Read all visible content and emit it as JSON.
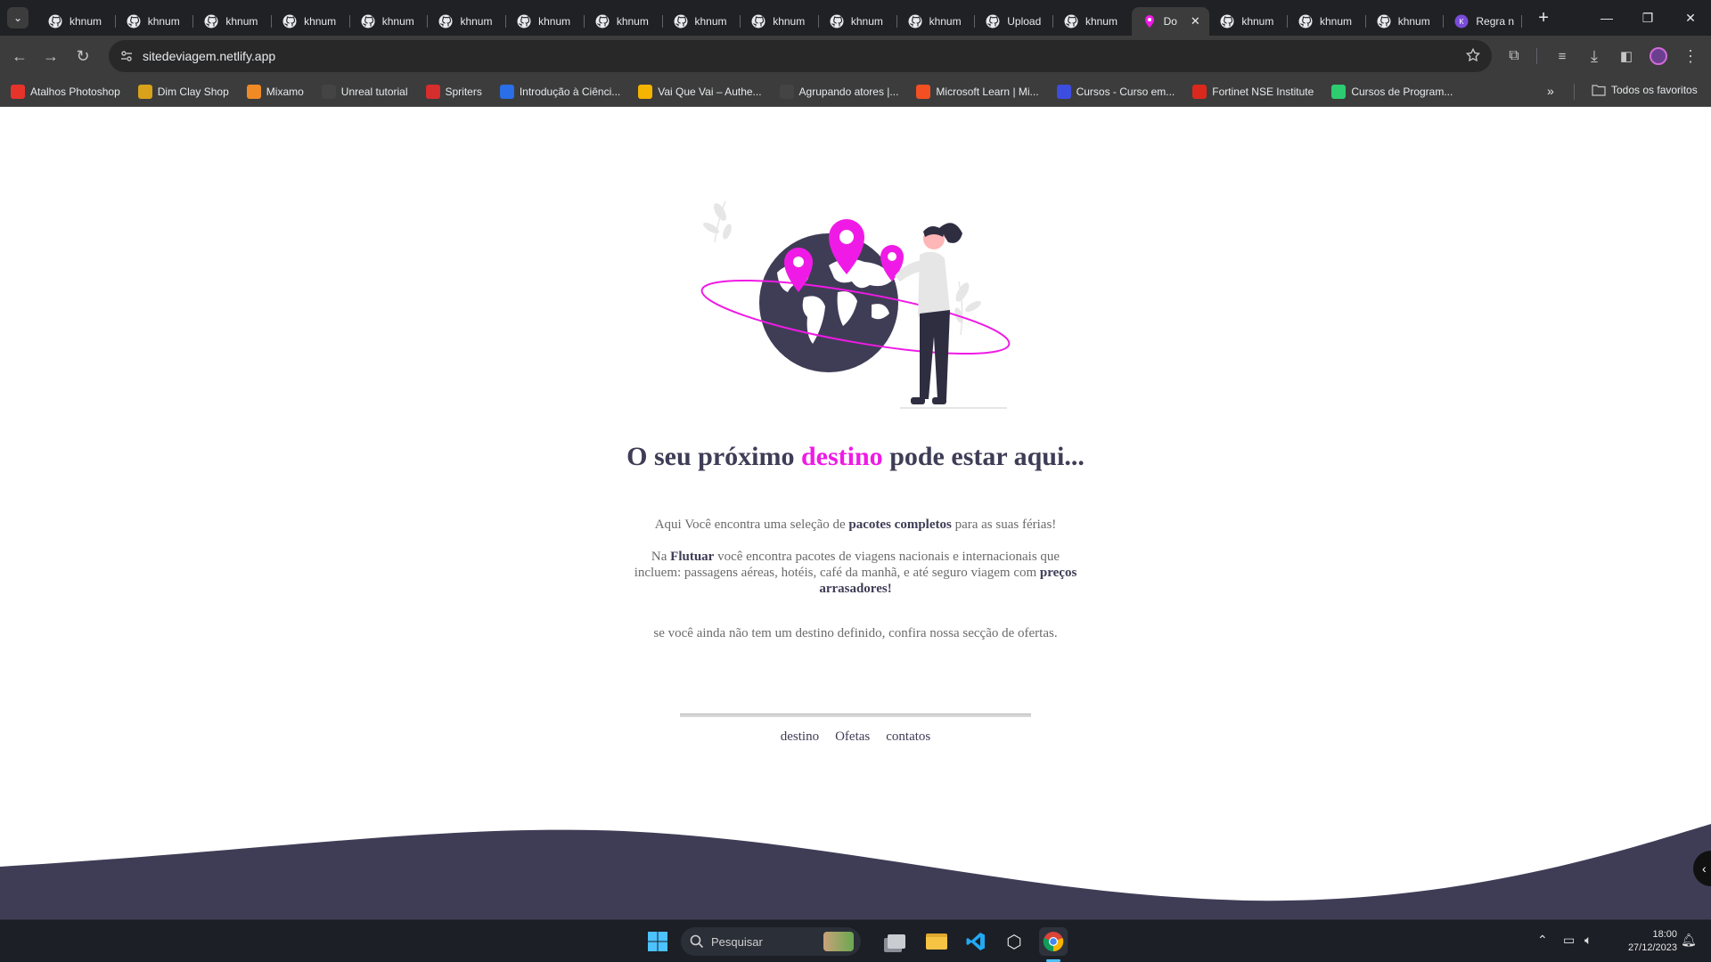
{
  "browser": {
    "tabs": [
      {
        "title": "khnum",
        "icon": "github-icon",
        "active": false
      },
      {
        "title": "khnum",
        "icon": "github-icon",
        "active": false
      },
      {
        "title": "khnum",
        "icon": "github-icon",
        "active": false
      },
      {
        "title": "khnum",
        "icon": "github-icon",
        "active": false
      },
      {
        "title": "khnum",
        "icon": "github-icon",
        "active": false
      },
      {
        "title": "khnum",
        "icon": "github-icon",
        "active": false
      },
      {
        "title": "khnum",
        "icon": "github-icon",
        "active": false
      },
      {
        "title": "khnum",
        "icon": "github-icon",
        "active": false
      },
      {
        "title": "khnum",
        "icon": "github-icon",
        "active": false
      },
      {
        "title": "khnum",
        "icon": "github-icon",
        "active": false
      },
      {
        "title": "khnum",
        "icon": "github-icon",
        "active": false
      },
      {
        "title": "khnum",
        "icon": "github-icon",
        "active": false
      },
      {
        "title": "Upload",
        "icon": "github-icon",
        "active": false
      },
      {
        "title": "khnum",
        "icon": "github-icon",
        "active": false
      },
      {
        "title": "Do",
        "icon": "map-pin-icon",
        "active": true
      },
      {
        "title": "khnum",
        "icon": "github-icon",
        "active": false
      },
      {
        "title": "khnum",
        "icon": "github-icon",
        "active": false
      },
      {
        "title": "khnum",
        "icon": "github-icon",
        "active": false
      },
      {
        "title": "Regra n",
        "icon": "app-icon",
        "active": false
      }
    ],
    "url": "sitedeviagem.netlify.app",
    "bookmarks": [
      {
        "label": "Atalhos Photoshop",
        "color": "#e8332a"
      },
      {
        "label": "Dim Clay Shop",
        "color": "#d9a21b"
      },
      {
        "label": "Mixamo",
        "color": "#f08a24"
      },
      {
        "label": "Unreal tutorial",
        "color": "#444444"
      },
      {
        "label": "Spriters",
        "color": "#d62d2d"
      },
      {
        "label": "Introdução à Ciênci...",
        "color": "#2a6ee8"
      },
      {
        "label": "Vai Que Vai – Authe...",
        "color": "#f5b400"
      },
      {
        "label": "Agrupando atores |...",
        "color": "#444444"
      },
      {
        "label": "Microsoft Learn | Mi...",
        "color": "#f25022"
      },
      {
        "label": "Cursos - Curso em...",
        "color": "#3d4de0"
      },
      {
        "label": "Fortinet NSE Institute",
        "color": "#da291c"
      },
      {
        "label": "Cursos de Program...",
        "color": "#2ecc71"
      }
    ],
    "all_bookmarks_label": "Todos os favoritos"
  },
  "page": {
    "headline_pre": "O seu próximo ",
    "headline_accent": "destino",
    "headline_post": " pode estar aqui...",
    "p1_pre": "Aqui Você encontra uma seleção de ",
    "p1_bold": "pacotes completos",
    "p1_post": " para as suas férias!",
    "p2_pre": "Na ",
    "p2_bold": "Flutuar",
    "p2_mid": " você encontra pacotes de viagens nacionais e internacionais que incluem: passagens aéreas, hotéis, café da manhã, e até seguro viagem com ",
    "p2_bold2": "preços arrasadores!",
    "p3": "se você ainda não tem um destino definido, confira nossa secção de ofertas.",
    "nav": [
      "destino",
      "Ofetas",
      "contatos"
    ],
    "colors": {
      "accent": "#f01ae6",
      "dark": "#3f3d56"
    }
  },
  "taskbar": {
    "search_placeholder": "Pesquisar",
    "time": "18:00",
    "date": "27/12/2023"
  }
}
